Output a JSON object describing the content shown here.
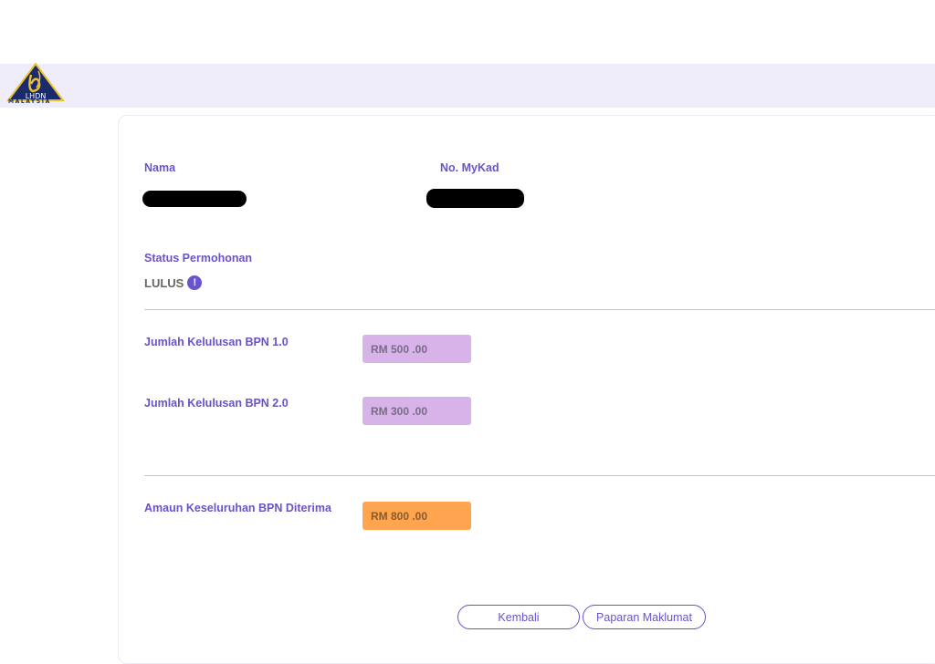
{
  "header": {
    "logo_text": "LHDN",
    "logo_subtext": "MALAYSIA"
  },
  "profile": {
    "name_label": "Nama",
    "mykad_label": "No. MyKad"
  },
  "status": {
    "label": "Status Permohonan",
    "value": "LULUS",
    "info_glyph": "!"
  },
  "amounts": {
    "bpn1_label": "Jumlah Kelulusan BPN 1.0",
    "bpn1_value": "RM 500 .00",
    "bpn2_label": "Jumlah Kelulusan BPN 2.0",
    "bpn2_value": "RM 300 .00",
    "total_label": "Amaun Keseluruhan BPN Diterima",
    "total_value": "RM 800 .00"
  },
  "actions": {
    "back_label": "Kembali",
    "details_label": "Paparan Maklumat"
  },
  "colors": {
    "accent": "#6b52c9",
    "header_bg": "#efedf9",
    "amount_bg": "#d7b3ea",
    "total_bg": "#ffa54f"
  }
}
